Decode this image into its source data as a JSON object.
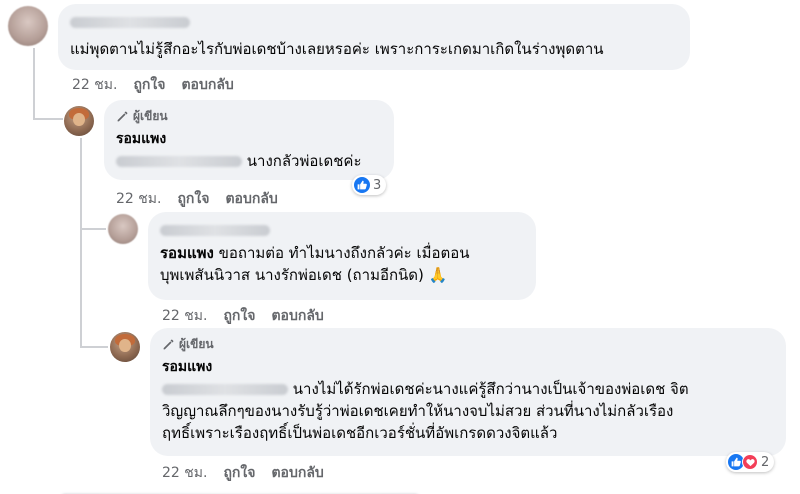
{
  "comments": [
    {
      "id": "c1",
      "body": "แม่พุดตานไม่รู้สึกอะไรกับพ่อเดชบ้างเลยหรอค่ะ เพราะการะเกดมาเกิดในร่างพุดตาน",
      "time": "22 ชม.",
      "like_label": "ถูกใจ",
      "reply_label": "ตอบกลับ"
    },
    {
      "id": "c2",
      "author_badge": "ผู้เขียน",
      "name": "รอมแพง",
      "body": "นางกลัวพ่อเดชค่ะ",
      "time": "22 ชม.",
      "like_label": "ถูกใจ",
      "reply_label": "ตอบกลับ",
      "reaction_count": "3"
    },
    {
      "id": "c3",
      "mention": "รอมแพง",
      "body_line1": "ขอถามต่อ ทำไมนางถึงกลัวค่ะ เมื่อตอน",
      "body_line2": "บุพเพสันนิวาส นางรักพ่อเดช (ถามอีกนิด) 🙏",
      "time": "22 ชม.",
      "like_label": "ถูกใจ",
      "reply_label": "ตอบกลับ"
    },
    {
      "id": "c4",
      "author_badge": "ผู้เขียน",
      "name": "รอมแพง",
      "body_line1": "นางไม่ได้รักพ่อเดชค่ะนางแค่รู้สึกว่านางเป็นเจ้าของพ่อเดช จิต",
      "body_line2": "วิญญาณลึกๆของนางรับรู้ว่าพ่อเดชเคยทำให้นางจบไม่สวย ส่วนที่นางไม่กลัวเรือง",
      "body_line3": "ฤทธิ์เพราะเรืองฤทธิ์เป็นพ่อเดชอีกเวอร์ชั่นที่อัพเกรดดวงจิตแล้ว",
      "time": "22 ชม.",
      "like_label": "ถูกใจ",
      "reply_label": "ตอบกลับ",
      "reaction_count": "2"
    }
  ],
  "colors": {
    "bubble": "#f0f2f5",
    "meta": "#65676b",
    "like": "#1877f2",
    "love": "#f33e58"
  }
}
